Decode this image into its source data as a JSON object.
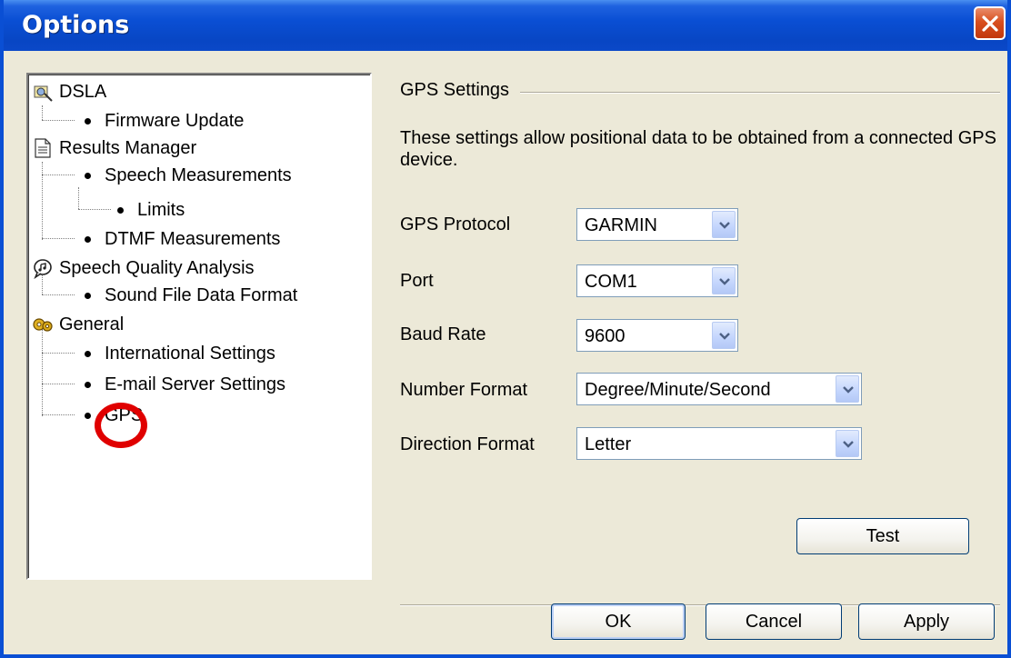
{
  "window": {
    "title": "Options"
  },
  "tree": {
    "items": [
      {
        "label": "DSLA",
        "icon": "dsla-icon"
      },
      {
        "label": "Firmware Update"
      },
      {
        "label": "Results Manager",
        "icon": "document-icon"
      },
      {
        "label": "Speech Measurements"
      },
      {
        "label": "Limits"
      },
      {
        "label": "DTMF Measurements"
      },
      {
        "label": "Speech Quality Analysis",
        "icon": "speech-icon"
      },
      {
        "label": "Sound File Data Format"
      },
      {
        "label": "General",
        "icon": "gears-icon"
      },
      {
        "label": "International Settings"
      },
      {
        "label": "E-mail Server Settings"
      },
      {
        "label": "GPS"
      }
    ],
    "highlight_color": "#e00000"
  },
  "gps": {
    "group_title": "GPS Settings",
    "description": "These settings allow positional data to be obtained from a connected GPS device.",
    "protocol_label": "GPS Protocol",
    "protocol_value": "GARMIN",
    "port_label": "Port",
    "port_value": "COM1",
    "baud_label": "Baud Rate",
    "baud_value": "9600",
    "number_format_label": "Number Format",
    "number_format_value": "Degree/Minute/Second",
    "direction_format_label": "Direction Format",
    "direction_format_value": "Letter",
    "test_label": "Test"
  },
  "footer": {
    "ok_label": "OK",
    "cancel_label": "Cancel",
    "apply_label": "Apply"
  }
}
